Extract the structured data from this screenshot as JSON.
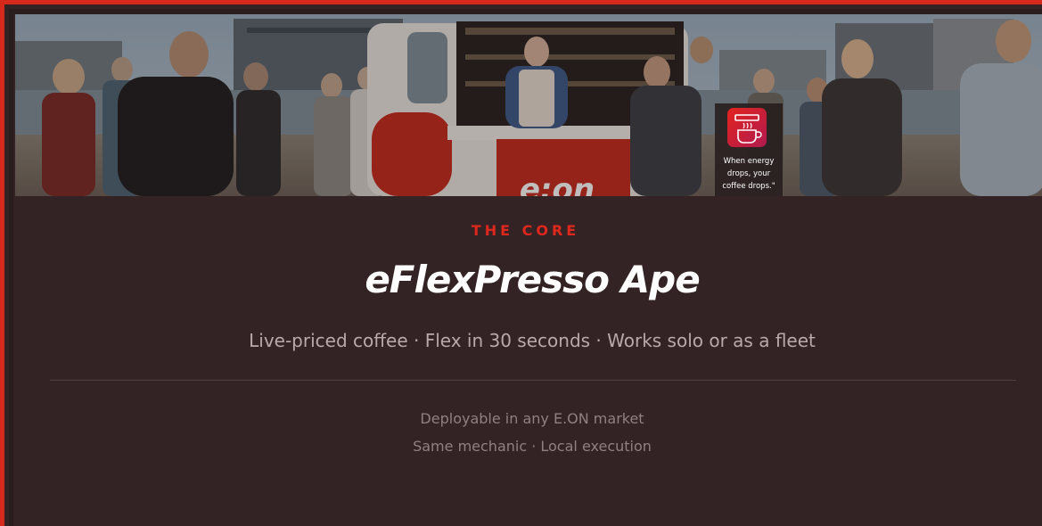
{
  "hero": {
    "logo_text": "e:on",
    "badge": {
      "icon": "coffee-cup-icon",
      "text": "When energy\ndrops, your\ncoffee drops.\""
    }
  },
  "content": {
    "eyebrow": "THE CORE",
    "title": "eFlexPresso Ape",
    "subtitle": "Live-priced coffee · Flex in 30 seconds · Works solo or as a fleet",
    "note_line_1": "Deployable in any E.ON market",
    "note_line_2": "Same mechanic · Local execution"
  },
  "colors": {
    "accent": "#e0271d",
    "frame_border": "#d7281c",
    "background": "#332324",
    "title": "#ffffff",
    "subtitle": "#b8aaa9",
    "note": "#8f8180"
  }
}
